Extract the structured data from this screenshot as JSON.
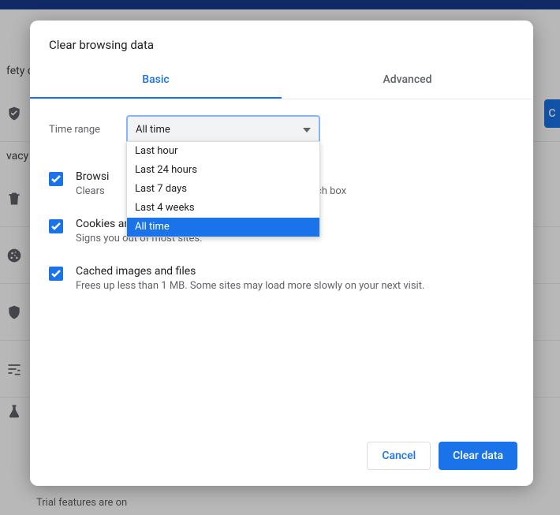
{
  "bg": {
    "rows": [
      "fety c",
      "",
      "vacy",
      "",
      "",
      "",
      "",
      ""
    ],
    "check_btn": "C",
    "trial_line": "Trial features are on"
  },
  "dialog": {
    "title": "Clear browsing data",
    "tabs": {
      "basic": "Basic",
      "advanced": "Advanced"
    },
    "timerange": {
      "label": "Time range",
      "selected": "All time",
      "options": [
        "Last hour",
        "Last 24 hours",
        "Last 7 days",
        "Last 4 weeks",
        "All time"
      ],
      "highlight_index": 4
    },
    "options": {
      "history": {
        "title": "Browsi",
        "desc_left": "Clears",
        "desc_right": "search box"
      },
      "cookies": {
        "title": "Cookies and other site data",
        "desc": "Signs you out of most sites."
      },
      "cache": {
        "title": "Cached images and files",
        "desc": "Frees up less than 1 MB. Some sites may load more slowly on your next visit."
      }
    },
    "buttons": {
      "cancel": "Cancel",
      "clear": "Clear data"
    }
  }
}
